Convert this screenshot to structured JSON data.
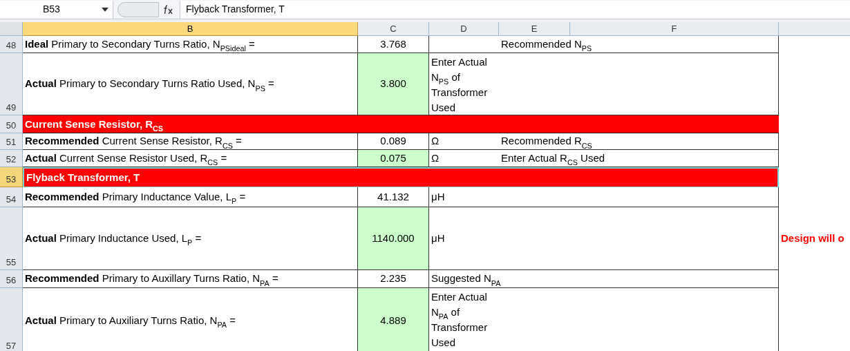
{
  "formula_bar": {
    "name_box": "B53",
    "formula": "Flyback Transformer, T"
  },
  "columns": [
    {
      "label": "B",
      "selected": true
    },
    {
      "label": "C",
      "selected": false
    },
    {
      "label": "D",
      "selected": false
    },
    {
      "label": "E",
      "selected": false
    },
    {
      "label": "F",
      "selected": false
    }
  ],
  "rows": [
    {
      "num": "48",
      "kind": "data",
      "selected": false,
      "label": "**Ideal** Primary to Secondary Turns Ratio, N$_{PSideal}$ =",
      "value": "3.768",
      "input": false,
      "e_note": "Recommended N$_{PS}$"
    },
    {
      "num": "49",
      "kind": "data",
      "selected": false,
      "label": "**Actual** Primary to Secondary Turns Ratio Used, N$_{PS}$  =",
      "value": "3.800",
      "input": true,
      "d_note": "Enter Actual N$_{PS}$ of Transformer Used",
      "wrap": true
    },
    {
      "num": "50",
      "kind": "section",
      "selected": false,
      "label": "Current Sense Resistor, R$_{CS}$"
    },
    {
      "num": "51",
      "kind": "data",
      "selected": false,
      "label": "**Recommended** Current Sense Resistor, R$_{CS}$ =",
      "value": "0.089",
      "input": false,
      "unit": "Ω",
      "e_note": "Recommended R$_{CS}$"
    },
    {
      "num": "52",
      "kind": "data",
      "selected": false,
      "label": "**Actual** Current Sense Resistor Used, R$_{CS}$ =",
      "value": "0.075",
      "input": true,
      "unit": "Ω",
      "e_note": "Enter Actual R$_{CS}$ Used"
    },
    {
      "num": "53",
      "kind": "section",
      "selected": true,
      "label": "Flyback Transformer, T"
    },
    {
      "num": "54",
      "kind": "data",
      "selected": false,
      "label": "**Recommended** Primary Inductance Value, L$_{P}$ =",
      "value": "41.132",
      "input": false,
      "unit": "μH"
    },
    {
      "num": "55",
      "kind": "data",
      "selected": false,
      "label": "**Actual** Primary Inductance Used, L$_{P}$ =",
      "value": "1140.000",
      "input": true,
      "unit": "μH",
      "warning": "Design will o"
    },
    {
      "num": "56",
      "kind": "data",
      "selected": false,
      "label": "**Recommended** Primary to Auxillary Turns Ratio, N$_{PA}$ =",
      "value": "2.235",
      "input": false,
      "d_note": "Suggested N$_{PA}$"
    },
    {
      "num": "57",
      "kind": "data",
      "selected": false,
      "label": "**Actual** Primary to Auxiliary Turns Ratio, N$_{PA}$ =",
      "value": "4.889",
      "input": true,
      "d_note": "Enter Actual N$_{PA}$ of Transformer Used",
      "wrap": true
    }
  ]
}
